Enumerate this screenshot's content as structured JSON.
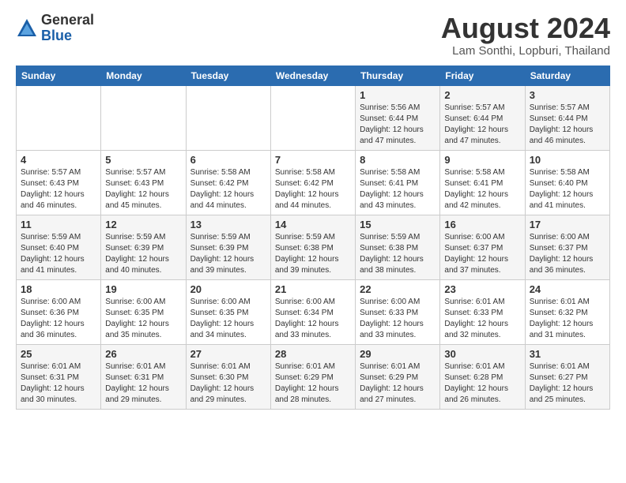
{
  "header": {
    "logo_general": "General",
    "logo_blue": "Blue",
    "title": "August 2024",
    "subtitle": "Lam Sonthi, Lopburi, Thailand"
  },
  "weekdays": [
    "Sunday",
    "Monday",
    "Tuesday",
    "Wednesday",
    "Thursday",
    "Friday",
    "Saturday"
  ],
  "weeks": [
    [
      {
        "day": "",
        "info": ""
      },
      {
        "day": "",
        "info": ""
      },
      {
        "day": "",
        "info": ""
      },
      {
        "day": "",
        "info": ""
      },
      {
        "day": "1",
        "info": "Sunrise: 5:56 AM\nSunset: 6:44 PM\nDaylight: 12 hours\nand 47 minutes."
      },
      {
        "day": "2",
        "info": "Sunrise: 5:57 AM\nSunset: 6:44 PM\nDaylight: 12 hours\nand 47 minutes."
      },
      {
        "day": "3",
        "info": "Sunrise: 5:57 AM\nSunset: 6:44 PM\nDaylight: 12 hours\nand 46 minutes."
      }
    ],
    [
      {
        "day": "4",
        "info": "Sunrise: 5:57 AM\nSunset: 6:43 PM\nDaylight: 12 hours\nand 46 minutes."
      },
      {
        "day": "5",
        "info": "Sunrise: 5:57 AM\nSunset: 6:43 PM\nDaylight: 12 hours\nand 45 minutes."
      },
      {
        "day": "6",
        "info": "Sunrise: 5:58 AM\nSunset: 6:42 PM\nDaylight: 12 hours\nand 44 minutes."
      },
      {
        "day": "7",
        "info": "Sunrise: 5:58 AM\nSunset: 6:42 PM\nDaylight: 12 hours\nand 44 minutes."
      },
      {
        "day": "8",
        "info": "Sunrise: 5:58 AM\nSunset: 6:41 PM\nDaylight: 12 hours\nand 43 minutes."
      },
      {
        "day": "9",
        "info": "Sunrise: 5:58 AM\nSunset: 6:41 PM\nDaylight: 12 hours\nand 42 minutes."
      },
      {
        "day": "10",
        "info": "Sunrise: 5:58 AM\nSunset: 6:40 PM\nDaylight: 12 hours\nand 41 minutes."
      }
    ],
    [
      {
        "day": "11",
        "info": "Sunrise: 5:59 AM\nSunset: 6:40 PM\nDaylight: 12 hours\nand 41 minutes."
      },
      {
        "day": "12",
        "info": "Sunrise: 5:59 AM\nSunset: 6:39 PM\nDaylight: 12 hours\nand 40 minutes."
      },
      {
        "day": "13",
        "info": "Sunrise: 5:59 AM\nSunset: 6:39 PM\nDaylight: 12 hours\nand 39 minutes."
      },
      {
        "day": "14",
        "info": "Sunrise: 5:59 AM\nSunset: 6:38 PM\nDaylight: 12 hours\nand 39 minutes."
      },
      {
        "day": "15",
        "info": "Sunrise: 5:59 AM\nSunset: 6:38 PM\nDaylight: 12 hours\nand 38 minutes."
      },
      {
        "day": "16",
        "info": "Sunrise: 6:00 AM\nSunset: 6:37 PM\nDaylight: 12 hours\nand 37 minutes."
      },
      {
        "day": "17",
        "info": "Sunrise: 6:00 AM\nSunset: 6:37 PM\nDaylight: 12 hours\nand 36 minutes."
      }
    ],
    [
      {
        "day": "18",
        "info": "Sunrise: 6:00 AM\nSunset: 6:36 PM\nDaylight: 12 hours\nand 36 minutes."
      },
      {
        "day": "19",
        "info": "Sunrise: 6:00 AM\nSunset: 6:35 PM\nDaylight: 12 hours\nand 35 minutes."
      },
      {
        "day": "20",
        "info": "Sunrise: 6:00 AM\nSunset: 6:35 PM\nDaylight: 12 hours\nand 34 minutes."
      },
      {
        "day": "21",
        "info": "Sunrise: 6:00 AM\nSunset: 6:34 PM\nDaylight: 12 hours\nand 33 minutes."
      },
      {
        "day": "22",
        "info": "Sunrise: 6:00 AM\nSunset: 6:33 PM\nDaylight: 12 hours\nand 33 minutes."
      },
      {
        "day": "23",
        "info": "Sunrise: 6:01 AM\nSunset: 6:33 PM\nDaylight: 12 hours\nand 32 minutes."
      },
      {
        "day": "24",
        "info": "Sunrise: 6:01 AM\nSunset: 6:32 PM\nDaylight: 12 hours\nand 31 minutes."
      }
    ],
    [
      {
        "day": "25",
        "info": "Sunrise: 6:01 AM\nSunset: 6:31 PM\nDaylight: 12 hours\nand 30 minutes."
      },
      {
        "day": "26",
        "info": "Sunrise: 6:01 AM\nSunset: 6:31 PM\nDaylight: 12 hours\nand 29 minutes."
      },
      {
        "day": "27",
        "info": "Sunrise: 6:01 AM\nSunset: 6:30 PM\nDaylight: 12 hours\nand 29 minutes."
      },
      {
        "day": "28",
        "info": "Sunrise: 6:01 AM\nSunset: 6:29 PM\nDaylight: 12 hours\nand 28 minutes."
      },
      {
        "day": "29",
        "info": "Sunrise: 6:01 AM\nSunset: 6:29 PM\nDaylight: 12 hours\nand 27 minutes."
      },
      {
        "day": "30",
        "info": "Sunrise: 6:01 AM\nSunset: 6:28 PM\nDaylight: 12 hours\nand 26 minutes."
      },
      {
        "day": "31",
        "info": "Sunrise: 6:01 AM\nSunset: 6:27 PM\nDaylight: 12 hours\nand 25 minutes."
      }
    ]
  ]
}
